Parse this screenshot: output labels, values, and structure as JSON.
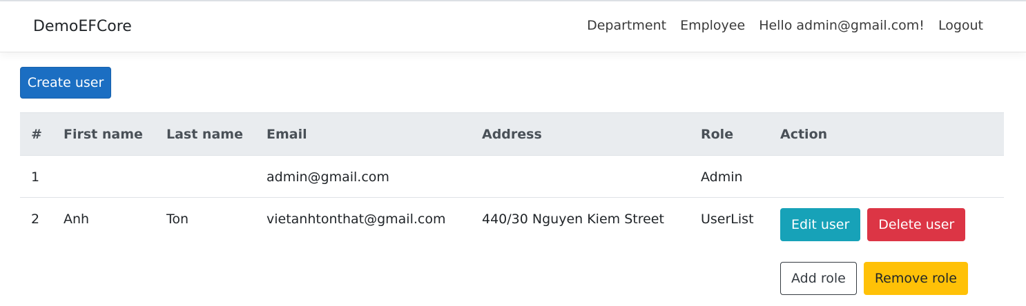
{
  "navbar": {
    "brand": "DemoEFCore",
    "links": [
      "Department",
      "Employee",
      "Hello admin@gmail.com!",
      "Logout"
    ]
  },
  "create_button_label": "Create user",
  "table": {
    "headers": [
      "#",
      "First name",
      "Last name",
      "Email",
      "Address",
      "Role",
      "Action"
    ],
    "rows": [
      {
        "index": "1",
        "first": "",
        "last": "",
        "email": "admin@gmail.com",
        "address": "",
        "role": "Admin"
      },
      {
        "index": "2",
        "first": "Anh",
        "last": "Ton",
        "email": "vietanhtonthat@gmail.com",
        "address": "440/30 Nguyen Kiem Street",
        "role": "UserList"
      }
    ]
  },
  "actions": {
    "edit": "Edit user",
    "delete": "Delete user",
    "add_role": "Add role",
    "remove_role": "Remove role"
  },
  "colors": {
    "primary": "#1b6ec2",
    "info": "#17a2b8",
    "danger": "#dc3545",
    "warning": "#ffc107",
    "header_bg": "#e9ecef"
  }
}
